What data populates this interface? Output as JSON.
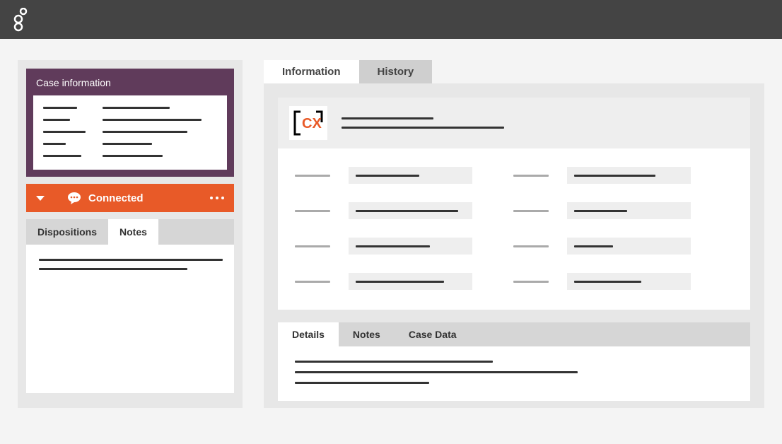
{
  "sidebar": {
    "case_info_title": "Case information"
  },
  "status": {
    "label": "Connected"
  },
  "left_tabs": {
    "dispositions": "Dispositions",
    "notes": "Notes"
  },
  "main_tabs": {
    "information": "Information",
    "history": "History"
  },
  "sub_tabs": {
    "details": "Details",
    "notes": "Notes",
    "case_data": "Case Data"
  },
  "brand": {
    "cx_label": "CX"
  },
  "colors": {
    "accent": "#e85a28",
    "purple": "#603b5b",
    "topbar": "#444444"
  }
}
